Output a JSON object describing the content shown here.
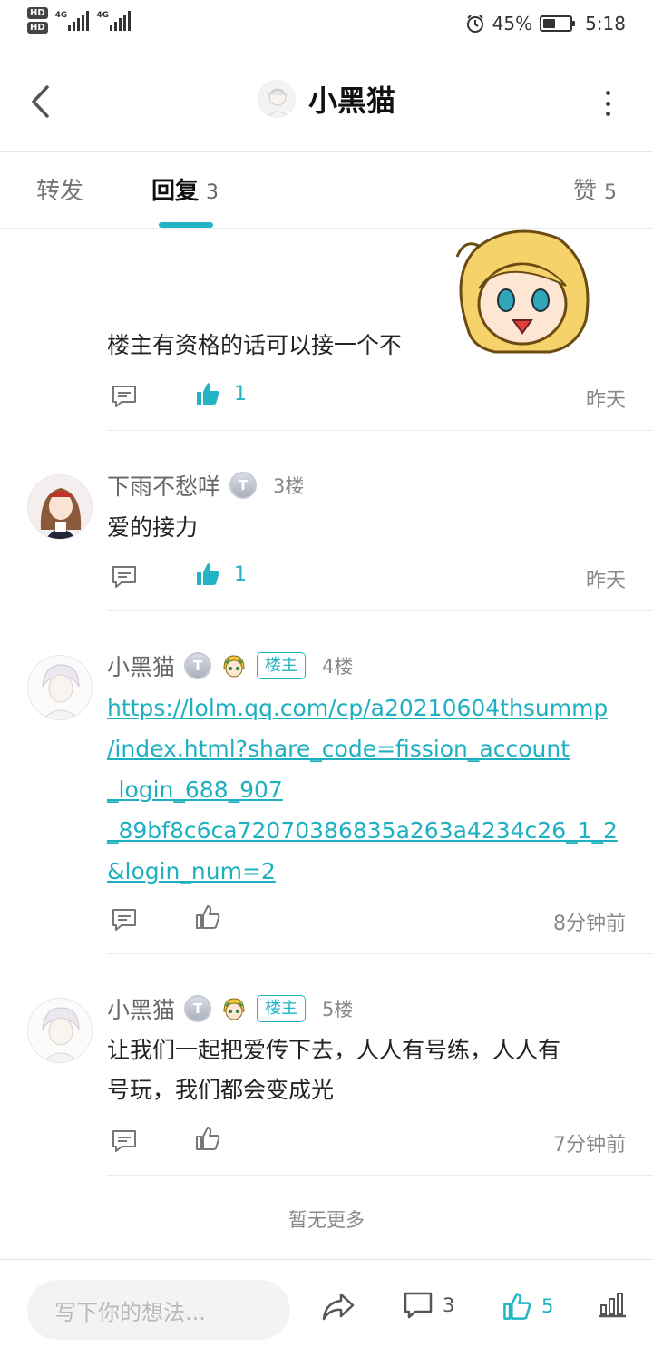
{
  "status_bar": {
    "hd1": "HD",
    "hd2": "HD",
    "net1": "4G",
    "net2": "4G",
    "battery_percent": "45%",
    "battery_level": 0.45,
    "time": "5:18"
  },
  "header": {
    "title": "小黑猫"
  },
  "tabs": {
    "forward": {
      "label": "转发"
    },
    "reply": {
      "label": "回复",
      "count": "3"
    },
    "like": {
      "label": "赞",
      "count": "5"
    }
  },
  "comments": [
    {
      "text": "楼主有资格的话可以接一个不",
      "likes": "1",
      "time": "昨天"
    },
    {
      "user": "下雨不愁咩",
      "level": "T",
      "floor": "3楼",
      "text": "爱的接力",
      "likes": "1",
      "time": "昨天"
    },
    {
      "user": "小黑猫",
      "level": "T",
      "owner_tag": "楼主",
      "floor": "4楼",
      "link_lines": [
        "https://lolm.qq.com/cp/a20210604thsummp",
        "/index.html?share_code=fission_account",
        "_login_688_907",
        "_89bf8c6ca72070386835a263a4234c26_1_2",
        "&login_num=2"
      ],
      "time": "8分钟前"
    },
    {
      "user": "小黑猫",
      "level": "T",
      "owner_tag": "楼主",
      "floor": "5楼",
      "text_lines": [
        "让我们一起把爱传下去，人人有号练，人人有",
        "号玩，我们都会变成光"
      ],
      "time": "7分钟前"
    }
  ],
  "footer_note": "暂无更多",
  "bottom_bar": {
    "input_placeholder": "写下你的想法...",
    "comment_count": "3",
    "like_count": "5"
  },
  "colors": {
    "accent": "#22b3c4",
    "link": "#1eb0c1",
    "muted": "#888888"
  }
}
